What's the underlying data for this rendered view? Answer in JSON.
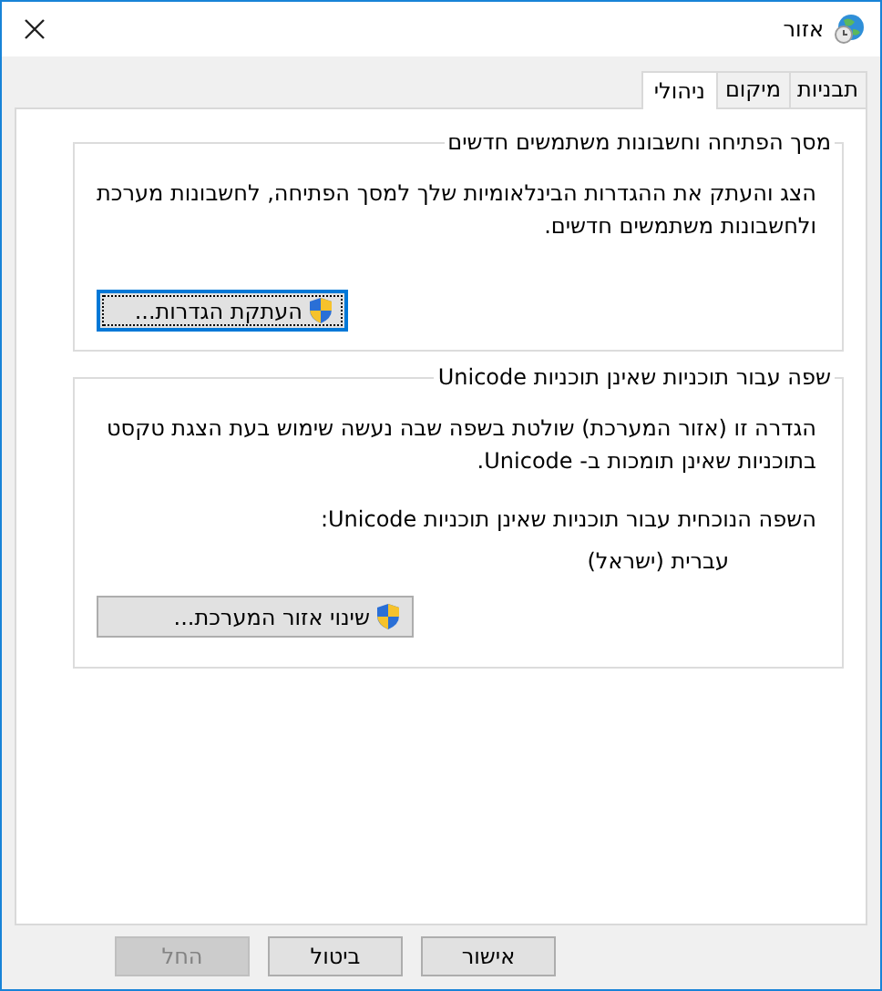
{
  "window": {
    "title": "אזור"
  },
  "tabs": [
    {
      "label": "תבניות",
      "selected": false
    },
    {
      "label": "מיקום",
      "selected": false
    },
    {
      "label": "ניהולי",
      "selected": true
    }
  ],
  "groups": [
    {
      "title": "מסך הפתיחה וחשבונות משתמשים חדשים",
      "description": "הצג והעתק את ההגדרות הבינלאומיות שלך למסך הפתיחה, לחשבונות מערכת ולחשבונות משתמשים חדשים.",
      "button": {
        "label": "העתקת הגדרות...",
        "focused": true
      }
    },
    {
      "title": "שפה עבור תוכניות שאינן תוכניות Unicode",
      "description": "הגדרה זו (אזור המערכת) שולטת בשפה שבה נעשה שימוש בעת הצגת טקסט בתוכניות שאינן תומכות ב- Unicode.",
      "current_label": "השפה הנוכחית עבור תוכניות שאינן תוכניות Unicode:",
      "current_value": "עברית (ישראל)",
      "button": {
        "label": "שינוי אזור המערכת...",
        "focused": false
      }
    }
  ],
  "buttons": [
    {
      "label": "אישור",
      "disabled": false
    },
    {
      "label": "ביטול",
      "disabled": false
    },
    {
      "label": "החל",
      "disabled": true
    }
  ]
}
